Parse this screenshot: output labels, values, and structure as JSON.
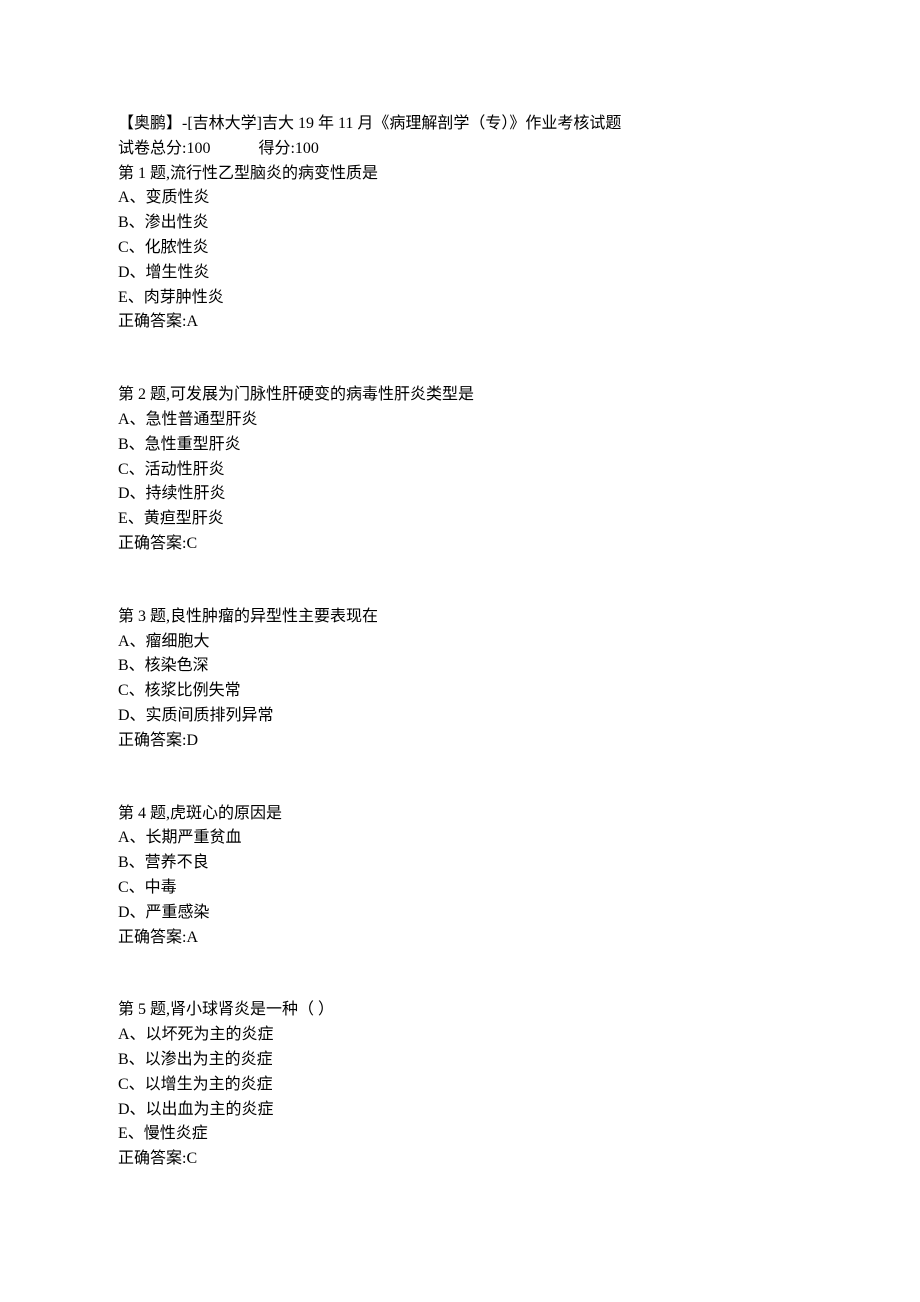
{
  "header": {
    "title": "【奥鹏】-[吉林大学]吉大 19 年 11 月《病理解剖学（专）》作业考核试题",
    "total_label": "试卷总分:",
    "total_value": "100",
    "score_label": "得分:",
    "score_value": "100"
  },
  "answer_label": "正确答案:",
  "questions": [
    {
      "stem": "第 1 题,流行性乙型脑炎的病变性质是",
      "options": [
        "A、变质性炎",
        "B、渗出性炎",
        "C、化脓性炎",
        "D、增生性炎",
        "E、肉芽肿性炎"
      ],
      "answer": "A"
    },
    {
      "stem": "第 2 题,可发展为门脉性肝硬变的病毒性肝炎类型是",
      "options": [
        "A、急性普通型肝炎",
        "B、急性重型肝炎",
        "C、活动性肝炎",
        "D、持续性肝炎",
        "E、黄疸型肝炎"
      ],
      "answer": "C"
    },
    {
      "stem": "第 3 题,良性肿瘤的异型性主要表现在",
      "options": [
        "A、瘤细胞大",
        "B、核染色深",
        "C、核浆比例失常",
        "D、实质间质排列异常"
      ],
      "answer": "D"
    },
    {
      "stem": "第 4 题,虎斑心的原因是",
      "options": [
        "A、长期严重贫血",
        "B、营养不良",
        "C、中毒",
        "D、严重感染"
      ],
      "answer": "A"
    },
    {
      "stem": "第 5 题,肾小球肾炎是一种（ ）",
      "options": [
        "A、以坏死为主的炎症",
        "B、以渗出为主的炎症",
        "C、以增生为主的炎症",
        "D、以出血为主的炎症",
        "E、慢性炎症"
      ],
      "answer": "C"
    }
  ]
}
